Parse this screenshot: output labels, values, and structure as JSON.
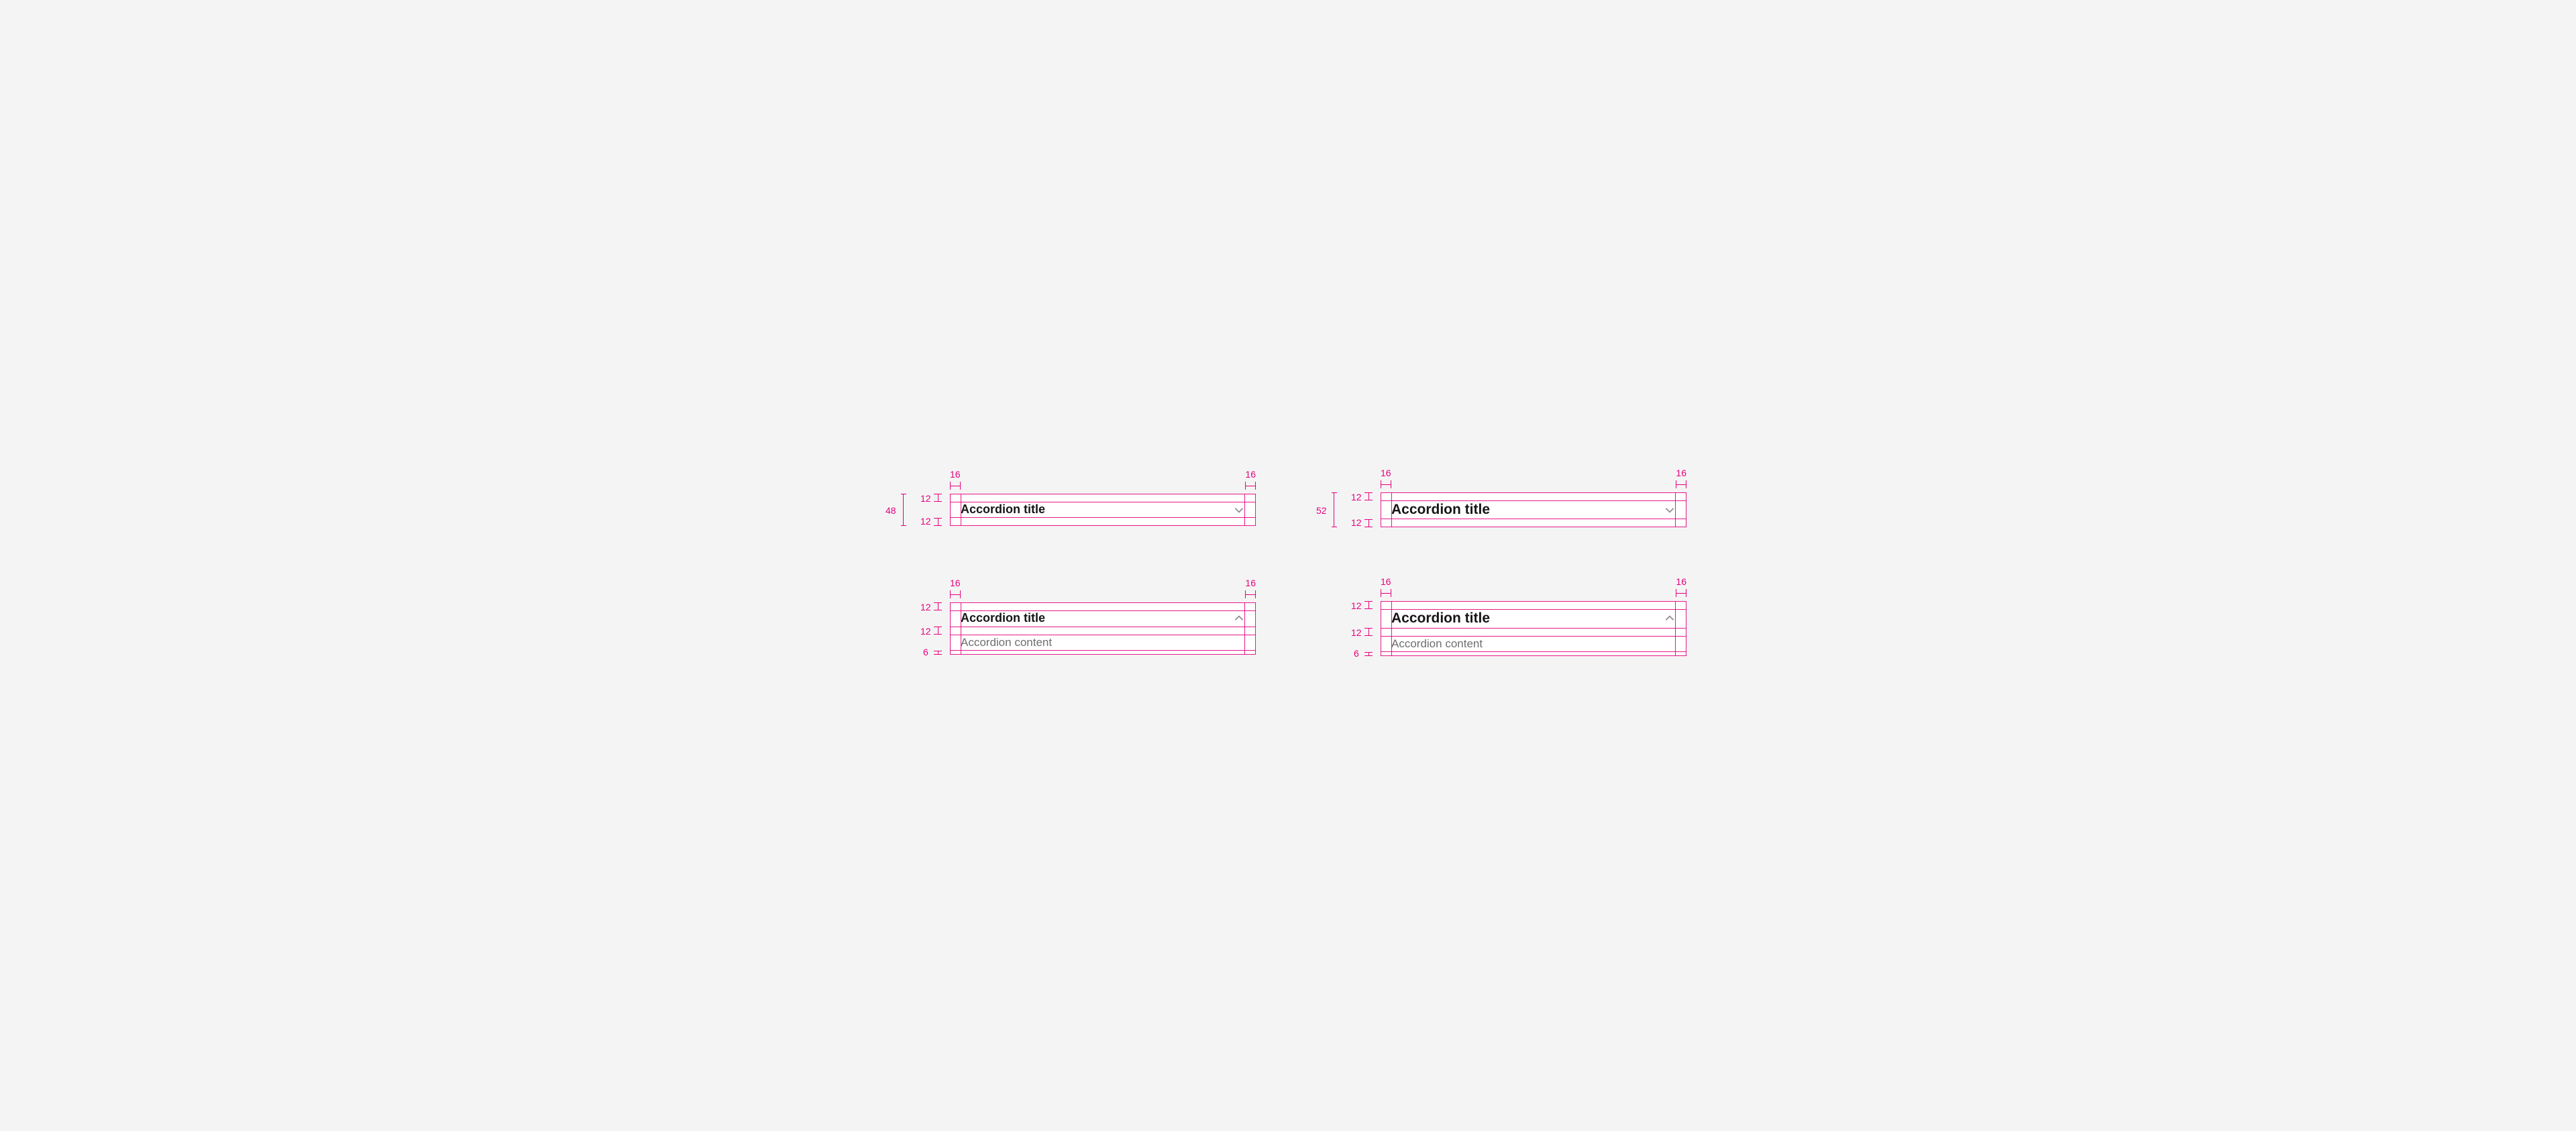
{
  "colors": {
    "spec": "#e6007e",
    "bg": "#f4f4f4",
    "title": "#161616",
    "content": "#6f6f6f",
    "chevron": "#8d8d8d"
  },
  "specs": [
    {
      "id": "small-collapsed",
      "title": "Accordion title",
      "height_label": "48",
      "pad_top": "12",
      "pad_bottom": "12",
      "pad_left": "16",
      "pad_right": "16"
    },
    {
      "id": "large-collapsed",
      "title": "Accordion title",
      "height_label": "52",
      "pad_top": "12",
      "pad_bottom": "12",
      "pad_left": "16",
      "pad_right": "16"
    },
    {
      "id": "small-expanded",
      "title": "Accordion title",
      "content": "Accordion content",
      "pad_top": "12",
      "pad_mid": "12",
      "pad_bottom": "6",
      "pad_left": "16",
      "pad_right": "16"
    },
    {
      "id": "large-expanded",
      "title": "Accordion title",
      "content": "Accordion content",
      "pad_top": "12",
      "pad_mid": "12",
      "pad_bottom": "6",
      "pad_left": "16",
      "pad_right": "16"
    }
  ]
}
